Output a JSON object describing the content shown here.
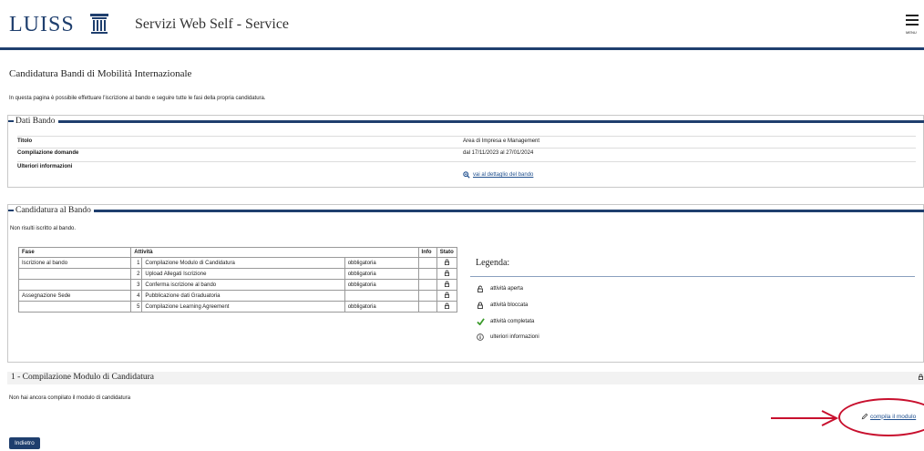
{
  "header": {
    "logo": "LUISS",
    "site_title": "Servizi Web Self - Service",
    "menu_label": "MENU"
  },
  "page": {
    "title": "Candidatura Bandi di Mobilità Internazionale",
    "intro": "In questa pagina è possibile effettuare l'iscrizione al bando e seguire tutte le fasi della propria candidatura."
  },
  "dati_bando": {
    "legend": "Dati Bando",
    "rows": [
      {
        "label": "Titolo",
        "value": "Area di Impresa e Management"
      },
      {
        "label": "Compilazione domande",
        "value": "dal 17/11/2023 al 27/01/2024"
      },
      {
        "label": "Ulteriori informazioni",
        "link": "vai al dettaglio del bando"
      }
    ]
  },
  "candidatura": {
    "legend": "Candidatura al Bando",
    "status": "Non risulti iscritto al bando.",
    "table": {
      "headers": {
        "fase": "Fase",
        "attivita": "Attività",
        "info": "Info",
        "stato": "Stato"
      },
      "rows": [
        {
          "fase": "Iscrizione al bando",
          "num": "1",
          "attivita": "Compilazione Modulo di Candidatura",
          "tipo": "obbligatoria"
        },
        {
          "fase": "",
          "num": "2",
          "attivita": "Upload Allegati Iscrizione",
          "tipo": "obbligatoria"
        },
        {
          "fase": "",
          "num": "3",
          "attivita": "Conferma iscrizione al bando",
          "tipo": "obbligatoria"
        },
        {
          "fase": "Assegnazione Sede",
          "num": "4",
          "attivita": "Pubblicazione dati Graduatoria",
          "tipo": ""
        },
        {
          "fase": "",
          "num": "5",
          "attivita": "Compilazione Learning Agreement",
          "tipo": "obbligatoria"
        }
      ]
    },
    "legenda": {
      "title": "Legenda:",
      "items": [
        {
          "icon": "unlock-icon",
          "label": "attività aperta"
        },
        {
          "icon": "lock-icon",
          "label": "attività bloccata"
        },
        {
          "icon": "check-icon",
          "label": "attività completata"
        },
        {
          "icon": "info-icon",
          "label": "ulteriori informazioni"
        }
      ]
    }
  },
  "modulo": {
    "title": "1 - Compilazione Modulo di Candidatura",
    "note": "Non hai ancora compilato il modulo di candidatura",
    "action": "compila il modulo"
  },
  "buttons": {
    "back": "Indietro"
  },
  "colors": {
    "brand": "#1f3f6e",
    "link": "#1f4f8e",
    "highlight": "#c8102e",
    "check": "#3a9a2a"
  }
}
